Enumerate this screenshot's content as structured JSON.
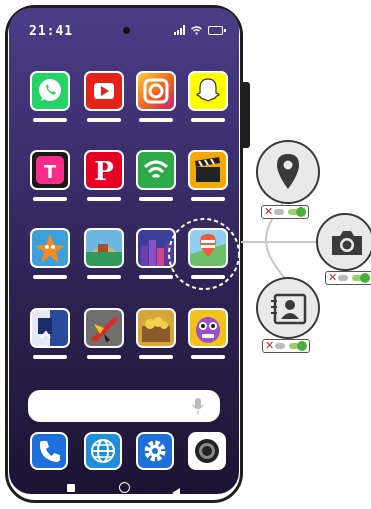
{
  "status_bar": {
    "time": "21:41"
  },
  "apps": [
    {
      "name": "whatsapp",
      "icon": "whatsapp-icon",
      "color": "#25d366"
    },
    {
      "name": "youtube",
      "icon": "youtube-icon",
      "color": "#e62117"
    },
    {
      "name": "camera-app",
      "icon": "camera-icon",
      "color": "#f7a21b"
    },
    {
      "name": "snapchat",
      "icon": "ghost-icon",
      "color": "#fffc00"
    },
    {
      "name": "tiktok-style",
      "icon": "tt-icon",
      "color": "#ff2b88"
    },
    {
      "name": "pinterest",
      "icon": "p-icon",
      "color": "#e60023"
    },
    {
      "name": "wifi-app",
      "icon": "wifi-icon",
      "color": "#2faa48"
    },
    {
      "name": "video-app",
      "icon": "clapperboard-icon",
      "color": "#f7a800"
    },
    {
      "name": "game-starfish",
      "icon": "starfish-icon",
      "color": "#3ea0d9"
    },
    {
      "name": "game-island",
      "icon": "island-icon",
      "color": "#6db7e1"
    },
    {
      "name": "game-city",
      "icon": "city-icon",
      "color": "#3b3f9a"
    },
    {
      "name": "maps-app",
      "icon": "map-pin-icon",
      "color": "#3a7bd5"
    },
    {
      "name": "game-soccer",
      "icon": "soccer-icon",
      "color": "#2a4b9b"
    },
    {
      "name": "game-jet",
      "icon": "jet-icon",
      "color": "#6f6f6f"
    },
    {
      "name": "game-treasure",
      "icon": "treasure-icon",
      "color": "#d7a63b"
    },
    {
      "name": "game-monster",
      "icon": "monster-icon",
      "color": "#f2c21c"
    }
  ],
  "dock": [
    {
      "name": "phone",
      "icon": "phone-icon",
      "color": "#1e6fd9"
    },
    {
      "name": "browser",
      "icon": "globe-icon",
      "color": "#1e8fd9"
    },
    {
      "name": "settings",
      "icon": "gear-icon",
      "color": "#1e6fd9"
    },
    {
      "name": "camera",
      "icon": "lens-icon",
      "color": "#ffffff"
    }
  ],
  "permissions": [
    {
      "name": "location",
      "icon": "location-pin-icon"
    },
    {
      "name": "camera",
      "icon": "camera-icon"
    },
    {
      "name": "contacts",
      "icon": "contacts-icon"
    }
  ]
}
